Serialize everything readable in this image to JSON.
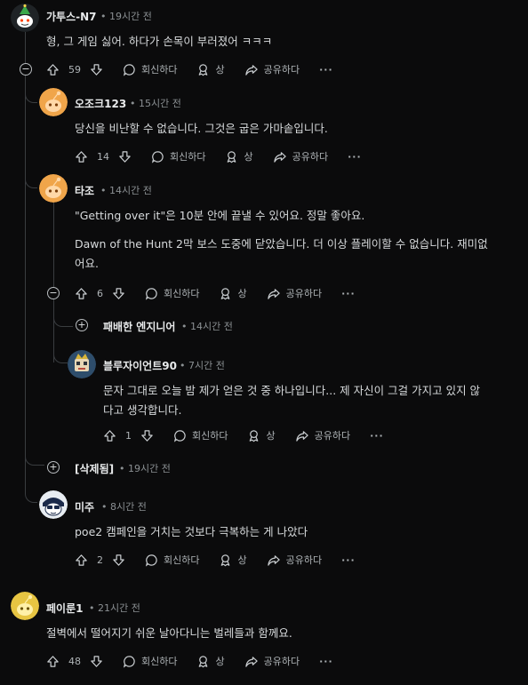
{
  "actions": {
    "reply": "회신하다",
    "award": "상",
    "share": "공유하다",
    "more": "···"
  },
  "separator": "•",
  "comments": [
    {
      "username": "가투스-N7",
      "time": "19시간 전",
      "body": [
        "형, 그 게임 싫어. 하다가 손목이 부러졌어 ㅋㅋㅋ"
      ],
      "votes": "59",
      "collapse": "−"
    },
    {
      "username": "오조크123",
      "time": "15시간 전",
      "body": [
        "당신을 비난할 수 없습니다. 그것은 굽은 가마솥입니다."
      ],
      "votes": "14"
    },
    {
      "username": "타조",
      "time": "14시간 전",
      "body": [
        "\"Getting over it\"은 10분 안에 끝낼 수 있어요. 정말 좋아요.",
        "",
        "Dawn of the Hunt 2막 보스 도중에 닫았습니다. 더 이상 플레이할 수 없습니다. 재미없",
        "어요."
      ],
      "votes": "6",
      "collapse": "−"
    },
    {
      "username": "패배한 엔지니어",
      "time": "14시간 전",
      "expand": "+"
    },
    {
      "username": "블루자이언트90",
      "time": "7시간 전",
      "body": [
        "문자 그대로 오늘 밤 제가 얻은 것 중 하나입니다... 제 자신이 그걸 가지고 있지 않",
        "다고 생각합니다."
      ],
      "votes": "1"
    },
    {
      "username": "[삭제됨]",
      "time": "19시간 전",
      "expand": "+"
    },
    {
      "username": "미주",
      "time": "8시간 전",
      "body": [
        "poe2 캠페인을 거치는 것보다 극복하는 게 나았다"
      ],
      "votes": "2"
    },
    {
      "username": "페이룬1",
      "time": "21시간 전",
      "body": [
        "절벽에서 떨어지기 쉬운 날아다니는 벌레들과 함께요."
      ],
      "votes": "48"
    }
  ],
  "colors": {
    "background": "#0b0b0c",
    "text": "#d7dadc",
    "muted": "#8b9093",
    "thread_line": "#3a3d40",
    "avatar_orange": "#f0a54a",
    "avatar_yellow": "#e7c542"
  }
}
